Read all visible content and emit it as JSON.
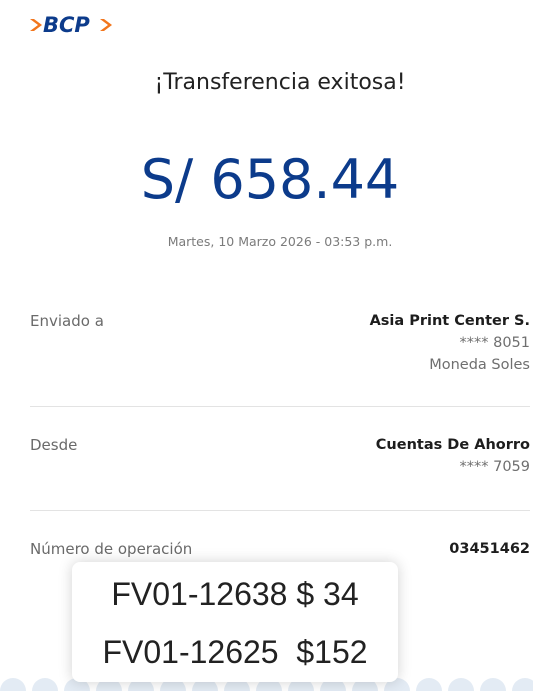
{
  "brand": {
    "name": "BCP",
    "colors": {
      "blue": "#0c3b8b",
      "orange": "#f2761d"
    }
  },
  "receipt": {
    "title": "¡Transferencia exitosa!",
    "amount": "S/ 658.44",
    "datetime": "Martes, 10 Marzo 2026 - 03:53 p.m.",
    "sent_to": {
      "label": "Enviado a",
      "name": "Asia Print Center S.",
      "account": "**** 8051",
      "currency": "Moneda Soles"
    },
    "from": {
      "label": "Desde",
      "account_type": "Cuentas De Ahorro",
      "account": "**** 7059"
    },
    "operation": {
      "label": "Número de operación",
      "number": "03451462"
    }
  },
  "note": {
    "lines": [
      "FV01-12638 $ 34",
      "FV01-12625  $152"
    ]
  }
}
